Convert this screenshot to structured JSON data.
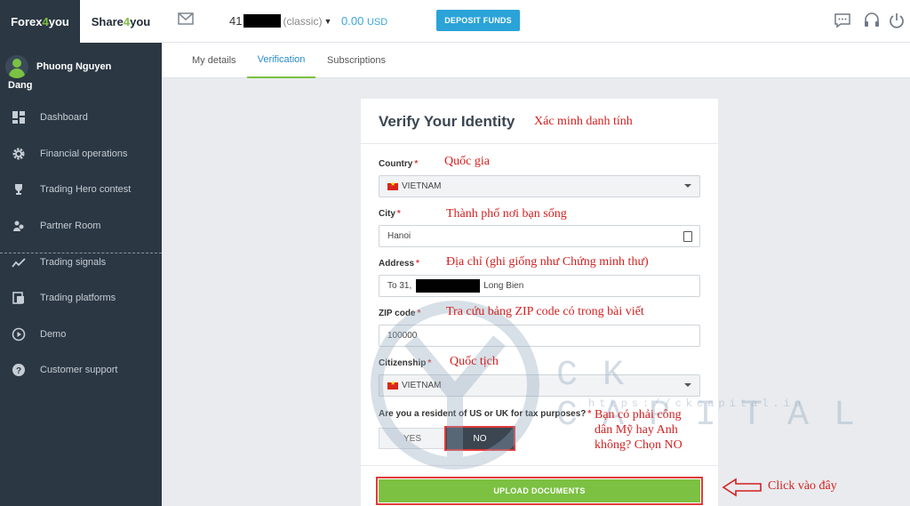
{
  "topbar": {
    "brand_forex_prefix": "Forex",
    "brand_forex_num": "4",
    "brand_forex_suffix": "you",
    "brand_share_prefix": "Share",
    "brand_share_num": "4",
    "brand_share_suffix": "you",
    "account_number_prefix": "41",
    "account_type": "(classic)",
    "balance_amount": "0.00",
    "balance_currency": "USD",
    "deposit_label": "DEPOSIT FUNDS",
    "icons": [
      "mail-icon",
      "chat-icon",
      "headset-icon",
      "power-icon"
    ]
  },
  "sidebar": {
    "user_first": "Phuong Nguyen",
    "user_last": "Dang",
    "items": [
      {
        "label": "Dashboard",
        "icon": "dashboard-icon"
      },
      {
        "label": "Financial operations",
        "icon": "gear-icon"
      },
      {
        "label": "Trading Hero contest",
        "icon": "trophy-icon"
      },
      {
        "label": "Partner Room",
        "icon": "partner-icon"
      },
      {
        "label": "Trading signals",
        "icon": "chart-line-icon"
      },
      {
        "label": "Trading platforms",
        "icon": "platforms-icon"
      },
      {
        "label": "Demo",
        "icon": "play-icon"
      },
      {
        "label": "Customer support",
        "icon": "help-icon"
      }
    ]
  },
  "tabs": [
    {
      "label": "My details",
      "active": false
    },
    {
      "label": "Verification",
      "active": true
    },
    {
      "label": "Subscriptions",
      "active": false
    }
  ],
  "form": {
    "title": "Verify Your Identity",
    "country_label": "Country",
    "country_value": "VIETNAM",
    "city_label": "City",
    "city_value": "Hanoi",
    "address_label": "Address",
    "address_prefix": "To 31,",
    "address_suffix": "Long Bien",
    "zip_label": "ZIP code",
    "zip_value": "100000",
    "citizenship_label": "Citizenship",
    "citizenship_value": "VIETNAM",
    "required_mark": "*",
    "resident_question": "Are you a resident of US or UK for tax purposes?",
    "yes_label": "YES",
    "no_label": "NO",
    "selected_option": "NO",
    "upload_label": "UPLOAD DOCUMENTS"
  },
  "annotations": {
    "title": "Xác minh danh tính",
    "country": "Quốc gia",
    "city": "Thành phố nơi bạn sống",
    "address": "Địa chỉ (ghi giống như Chứng minh thư)",
    "zip": "Tra cứu bảng ZIP code có trong bài viết",
    "citizenship": "Quốc tịch",
    "resident": "Bạn có phải công dân Mỹ hay Anh không? Chọn NO",
    "click_here": "Click vào đây"
  },
  "watermark": {
    "text": "CK CAPITAL",
    "url": "https://ckcapital.io"
  },
  "colors": {
    "sidebar_bg": "#2b3743",
    "accent_green": "#7cc142",
    "accent_blue": "#2aa3d8",
    "annotation_red": "#d42020"
  }
}
